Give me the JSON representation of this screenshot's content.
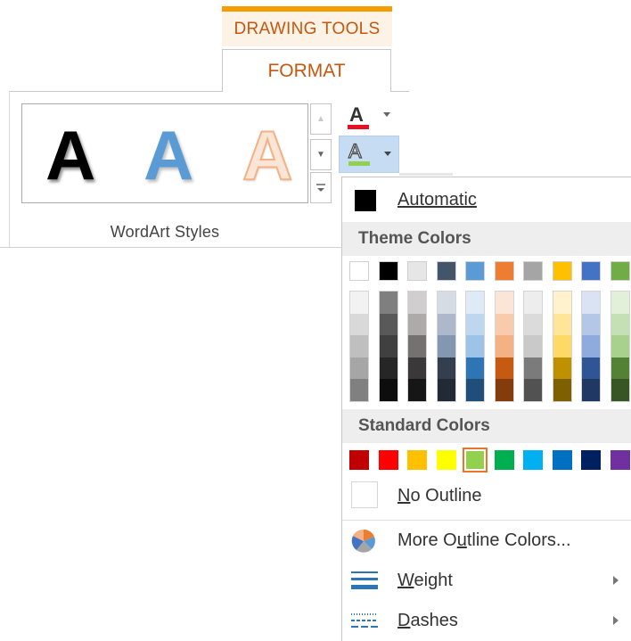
{
  "tab_group": "DRAWING TOOLS",
  "tab": "FORMAT",
  "group_label": "WordArt Styles",
  "gallery": [
    {
      "glyph": "A",
      "style": "black"
    },
    {
      "glyph": "A",
      "style": "blue"
    },
    {
      "glyph": "A",
      "style": "orange-outline"
    }
  ],
  "text_fill": {
    "glyph": "A",
    "bar_color": "#e81123"
  },
  "text_outline": {
    "glyph": "A",
    "bar_color": "#92d050"
  },
  "menu": {
    "automatic": {
      "label": "Automatic",
      "swatch": "#000000"
    },
    "theme_header": "Theme Colors",
    "theme_columns": [
      [
        "#ffffff",
        "#f2f2f2",
        "#d9d9d9",
        "#bfbfbf",
        "#a6a6a6",
        "#808080"
      ],
      [
        "#000000",
        "#7f7f7f",
        "#595959",
        "#404040",
        "#262626",
        "#0d0d0d"
      ],
      [
        "#e7e6e6",
        "#d0cece",
        "#aeaaaa",
        "#757171",
        "#3a3838",
        "#171616"
      ],
      [
        "#44546a",
        "#d6dce4",
        "#adb9ca",
        "#8497b0",
        "#333f4f",
        "#222a35"
      ],
      [
        "#5b9bd5",
        "#deebf6",
        "#bdd7ee",
        "#9dc3e6",
        "#2e75b5",
        "#1f4e79"
      ],
      [
        "#ed7d31",
        "#fbe5d6",
        "#f8cbad",
        "#f4b183",
        "#c55a11",
        "#843c0c"
      ],
      [
        "#a5a5a5",
        "#ededed",
        "#dbdbdb",
        "#c9c9c9",
        "#7b7b7b",
        "#525252"
      ],
      [
        "#ffc000",
        "#fff2cc",
        "#fee599",
        "#ffd965",
        "#bf9000",
        "#7f6000"
      ],
      [
        "#4472c4",
        "#dae3f3",
        "#b4c7e7",
        "#8faadc",
        "#2f5597",
        "#203864"
      ],
      [
        "#70ad47",
        "#e2f0d9",
        "#c5e0b4",
        "#a9d18e",
        "#538135",
        "#375623"
      ]
    ],
    "standard_header": "Standard Colors",
    "standard_colors": [
      "#c00000",
      "#ff0000",
      "#ffc000",
      "#ffff00",
      "#92d050",
      "#00b050",
      "#00b0f0",
      "#0070c0",
      "#002060",
      "#7030a0"
    ],
    "selected_standard": 4,
    "no_outline": "No Outline",
    "more_colors": "More Outline Colors...",
    "weight": "Weight",
    "dashes": "Dashes"
  }
}
